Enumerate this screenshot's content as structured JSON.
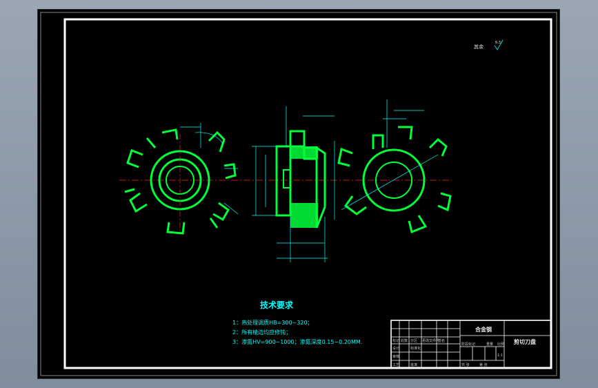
{
  "drawing": {
    "roughness_label": "其余",
    "roughness_value": "6.3",
    "requirements_title": "技术要求",
    "requirements": [
      "1：热处理调质HB=300~320；",
      "2：所有棱边均应修钝；",
      "3：渗氮HV=900~1000；渗氮深度0.15~0.20MM."
    ]
  },
  "title_block": {
    "material": "合金钢",
    "part_name": "剪切刀盘",
    "scale": "1:1",
    "small_labels": [
      "标记",
      "处数",
      "分区",
      "更改文件号",
      "签名",
      "设计",
      "标准化",
      "阶段标记",
      "重量",
      "比例",
      "审核",
      "工艺",
      "批准",
      "共 张",
      "第 张"
    ]
  },
  "colors": {
    "sheet_bg": "#000000",
    "frame": "#ffffff",
    "part": "#00ff3a",
    "dimension": "#00ffff",
    "centerline": "#ff2020",
    "desktop": "#8b97a6"
  }
}
